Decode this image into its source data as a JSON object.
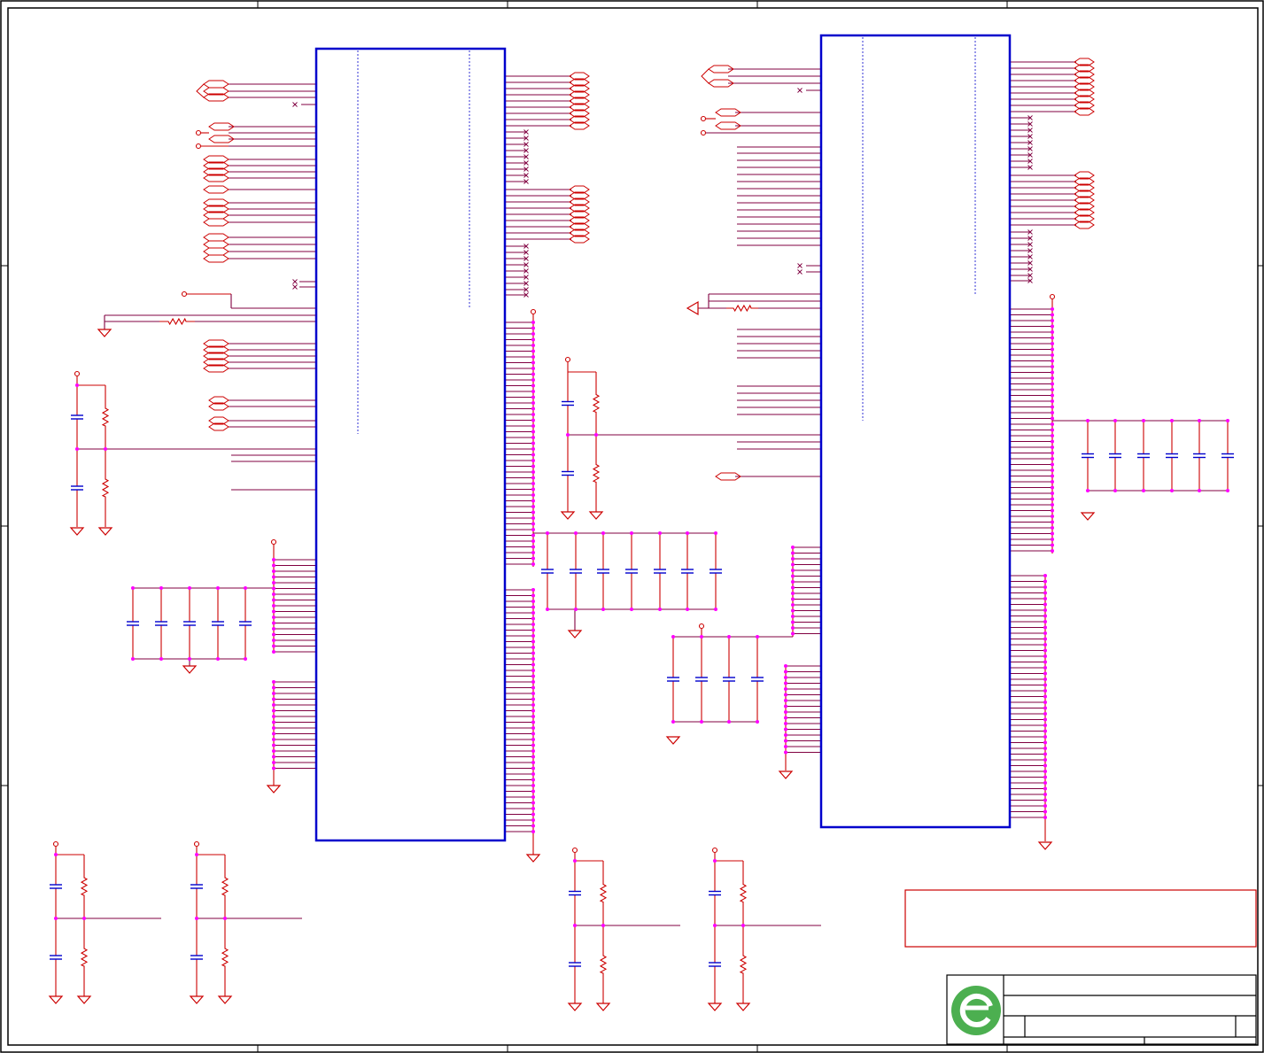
{
  "sheet": {
    "title_block": {
      "title": "",
      "size": "",
      "document_number": "",
      "revision": "",
      "date": "",
      "sheet": ""
    },
    "note_box_text": ""
  },
  "colors": {
    "border": "#000000",
    "chip_outline": "#0000cc",
    "wire": "#800040",
    "part": "#cc0000",
    "capacitor_plate": "#0000cc",
    "junction": "#ff00ff",
    "logo_green": "#4caf50"
  },
  "icons": {
    "logo": "company-logo-icon",
    "ground": "ground-symbol-icon",
    "power": "power-port-icon",
    "resistor": "resistor-icon",
    "capacitor": "capacitor-icon",
    "offpage": "offpage-connector-icon"
  }
}
